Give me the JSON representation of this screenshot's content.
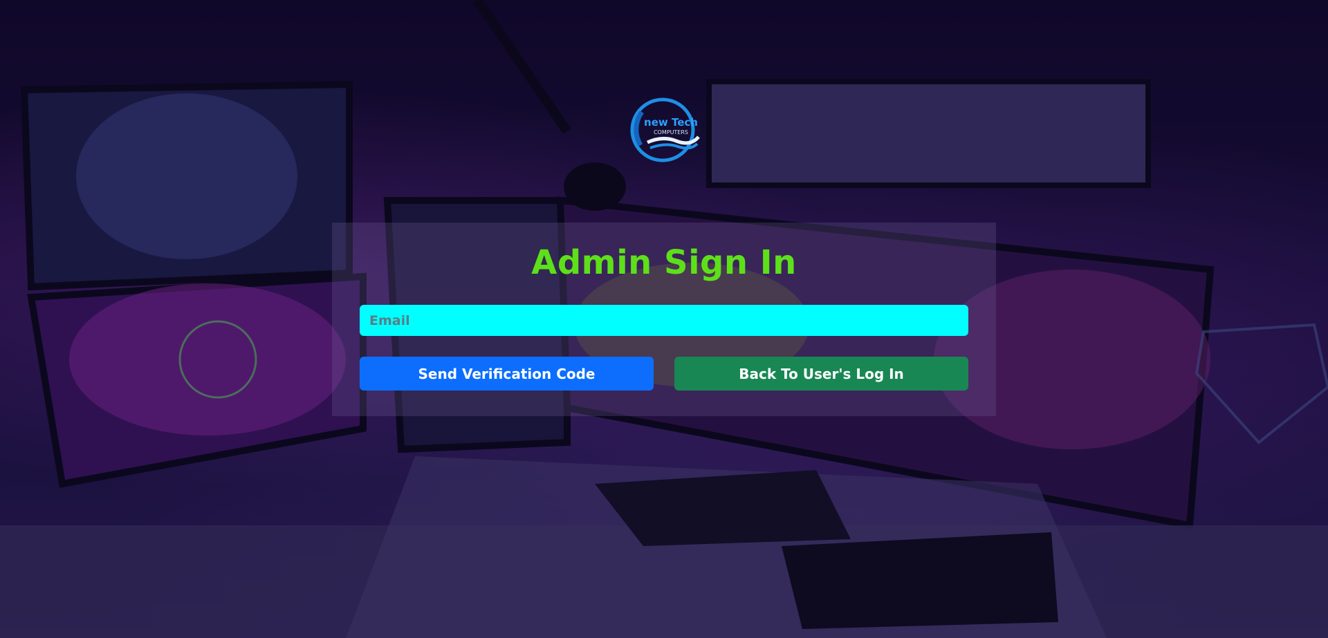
{
  "logo": {
    "line1": "new Tech",
    "line2": "COMPUTERS"
  },
  "form": {
    "title": "Admin Sign In",
    "email_placeholder": "Email",
    "send_label": "Send Verification Code",
    "back_label": "Back To User's Log In"
  },
  "colors": {
    "title": "#5de01a",
    "email_bg": "#00ffff",
    "send_btn": "#0d6efd",
    "back_btn": "#198754"
  }
}
